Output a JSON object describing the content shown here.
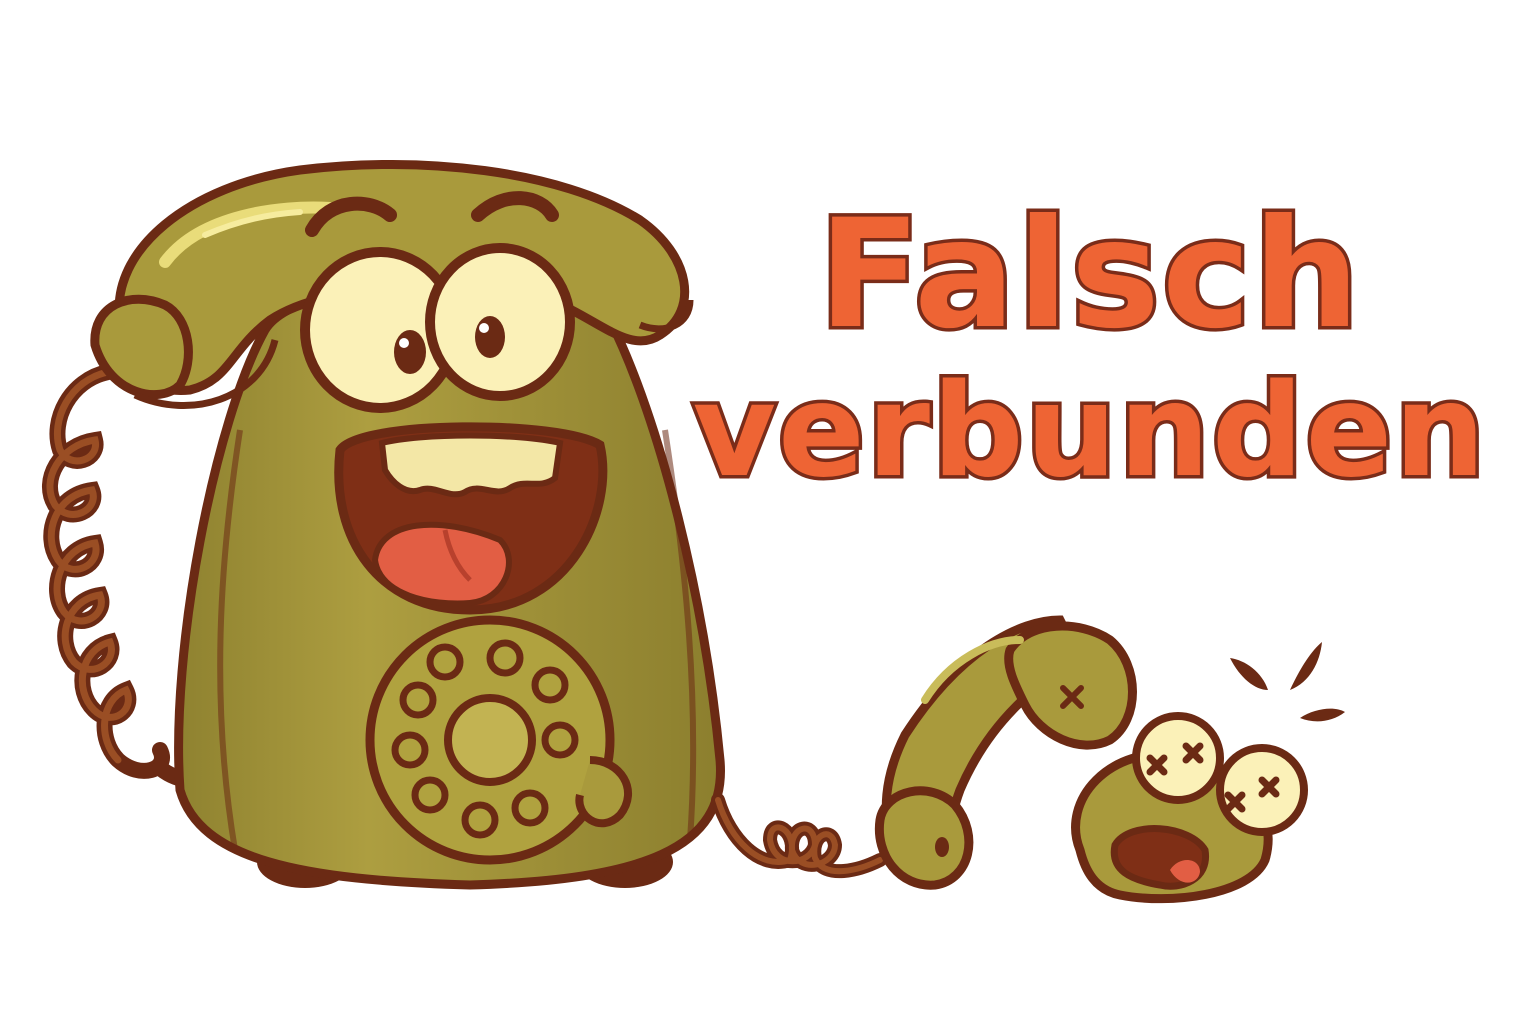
{
  "title": {
    "line1": "Falsch",
    "line2": "verbunden"
  },
  "colors": {
    "background": "#ffffff",
    "title_fill": "#ee6434",
    "title_outline": "#7a2c19",
    "phone_body": "#a99a3c",
    "phone_shadow": "#8a7d2c",
    "outline": "#6b2a14",
    "eye_white": "#fbf1b8",
    "mouth": "#7f2f16",
    "tongue": "#e25e44",
    "cord": "#7d3a1b"
  },
  "icons": [
    "rotary-phone-character-icon",
    "handset-icon",
    "coiled-cord-icon",
    "dizzy-face-icon",
    "splash-drops-icon"
  ]
}
